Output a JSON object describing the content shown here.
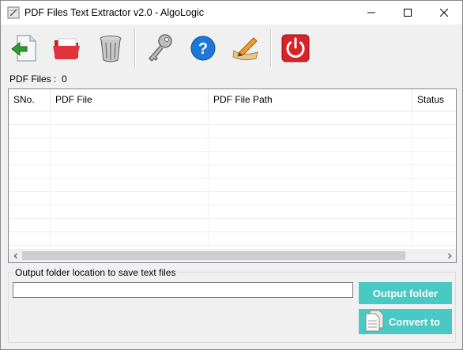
{
  "window": {
    "title": "PDF Files Text Extractor v2.0 - AlgoLogic"
  },
  "toolbar": {
    "buttons": [
      {
        "name": "add-file",
        "icon": "add-file-icon"
      },
      {
        "name": "open-folder",
        "icon": "folder-icon"
      },
      {
        "name": "clear-list",
        "icon": "trash-bin-icon"
      },
      {
        "name": "register",
        "icon": "key-icon"
      },
      {
        "name": "help",
        "icon": "help-icon"
      },
      {
        "name": "feedback",
        "icon": "edit-icon"
      },
      {
        "name": "exit",
        "icon": "power-icon"
      }
    ]
  },
  "status": {
    "pdf_files_label": "PDF Files :",
    "pdf_files_count": "0"
  },
  "table": {
    "columns": [
      "SNo.",
      "PDF File",
      "PDF File Path",
      "Status"
    ],
    "rows": []
  },
  "output": {
    "group_label": "Output folder location to save text files",
    "folder_value": "",
    "output_folder_button": "Output folder",
    "convert_button": "Convert to"
  },
  "colors": {
    "accent": "#48c9c4",
    "power_red": "#d9232a",
    "help_blue": "#1e78d8"
  }
}
